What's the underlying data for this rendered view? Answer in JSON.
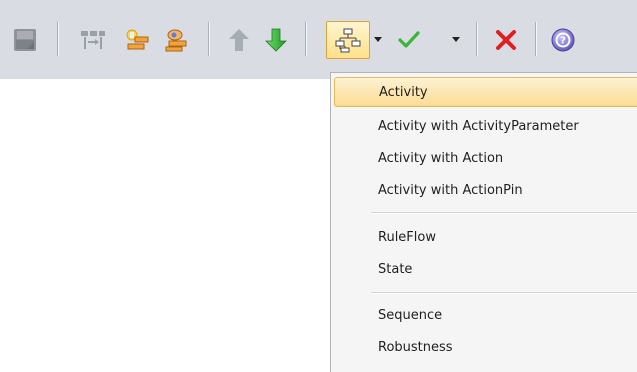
{
  "toolbar": {
    "icons": [
      "save-icon",
      "layout-icon",
      "add-element-icon",
      "add-linked-element-icon",
      "move-up-icon",
      "move-down-icon",
      "diagram-type-icon",
      "dropdown-arrow-icon",
      "checkmark-icon",
      "dropdown-arrow-icon",
      "delete-icon",
      "help-icon"
    ]
  },
  "menu": {
    "items": [
      {
        "label": "Activity",
        "highlighted": true
      },
      {
        "label": "Activity with ActivityParameter"
      },
      {
        "label": "Activity with Action"
      },
      {
        "label": "Activity with ActionPin"
      },
      {
        "label": "RuleFlow"
      },
      {
        "label": "State"
      },
      {
        "label": "Sequence"
      },
      {
        "label": "Robustness"
      }
    ]
  },
  "colors": {
    "toolbar_bg": "#d9dde3",
    "menu_bg": "#f5f5f5",
    "highlight": "#fbdc92",
    "arrow_green": "#3cb43c",
    "delete_red": "#e02020",
    "help_purple": "#7a6fc9"
  }
}
